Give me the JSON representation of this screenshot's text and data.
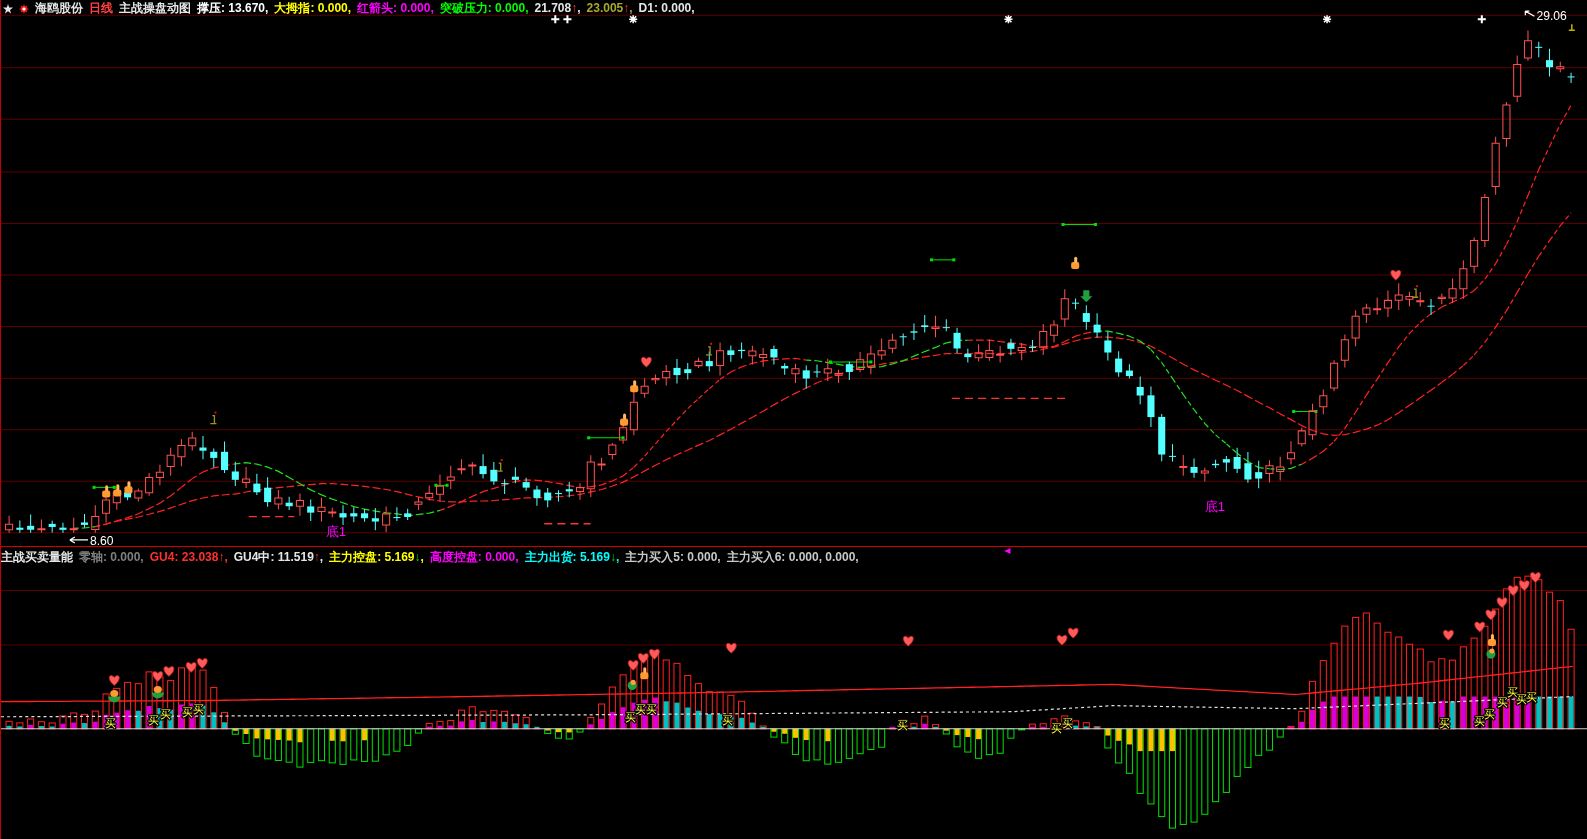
{
  "price_panel": {
    "legend": [
      {
        "text": "海鸥股份",
        "color": "#e6e6e6"
      },
      {
        "text": "日线",
        "color": "#ff4040"
      },
      {
        "text": "主战操盘动图",
        "color": "#e6e6e6"
      },
      {
        "text": "撑压: 13.670,",
        "color": "#ffffff"
      },
      {
        "text": "大拇指: 0.000,",
        "color": "#ffff00"
      },
      {
        "text": "红箭头: 0.000,",
        "color": "#ff00ff"
      },
      {
        "text": "突破压力: 0.000,",
        "color": "#00ff00"
      },
      {
        "text": "21.708",
        "arrow": "↑",
        "rising": true,
        "suffix": ",",
        "color": "#e6e6e6"
      },
      {
        "text": "23.005",
        "arrow": "↑",
        "rising": true,
        "suffix": ",",
        "color": "#a8a830"
      },
      {
        "text": "D1: 0.000,",
        "color": "#e6e6e6"
      }
    ],
    "low_price": "8.60",
    "high_price": "29.06",
    "bottom_labels": [
      "底1",
      "底1"
    ]
  },
  "indicator_panel": {
    "legend": [
      {
        "text": "主战买卖量能",
        "color": "#e6e6e6"
      },
      {
        "text": "零轴: 0.000,",
        "color": "#808080"
      },
      {
        "text": "GU4: 23.038",
        "arrow": "↑",
        "rising": true,
        "suffix": ",",
        "color": "#ff3030"
      },
      {
        "text": "GU4中: 11.519",
        "arrow": "↑",
        "rising": true,
        "suffix": ",",
        "color": "#e6e6e6"
      },
      {
        "text": "主力控盘: 5.169",
        "arrow": "↓",
        "rising": false,
        "suffix": ",",
        "color": "#ffff00"
      },
      {
        "text": "高度控盘: 0.000,",
        "color": "#ff00ff"
      },
      {
        "text": "主力出货: 5.169",
        "arrow": "↓",
        "rising": false,
        "suffix": ",",
        "color": "#00ffff"
      },
      {
        "text": "主力买入5: 0.000,",
        "color": "#c8c8c8"
      },
      {
        "text": "主力买入6: 0.000, 0.000,",
        "color": "#c8c8c8"
      }
    ],
    "buy_labels": [
      "买",
      "买",
      "买",
      "买",
      "买",
      "买",
      "买",
      "买",
      "买",
      "买",
      "买",
      "买",
      "买",
      "买",
      "买",
      "买",
      "买",
      "买",
      "买"
    ]
  }
}
